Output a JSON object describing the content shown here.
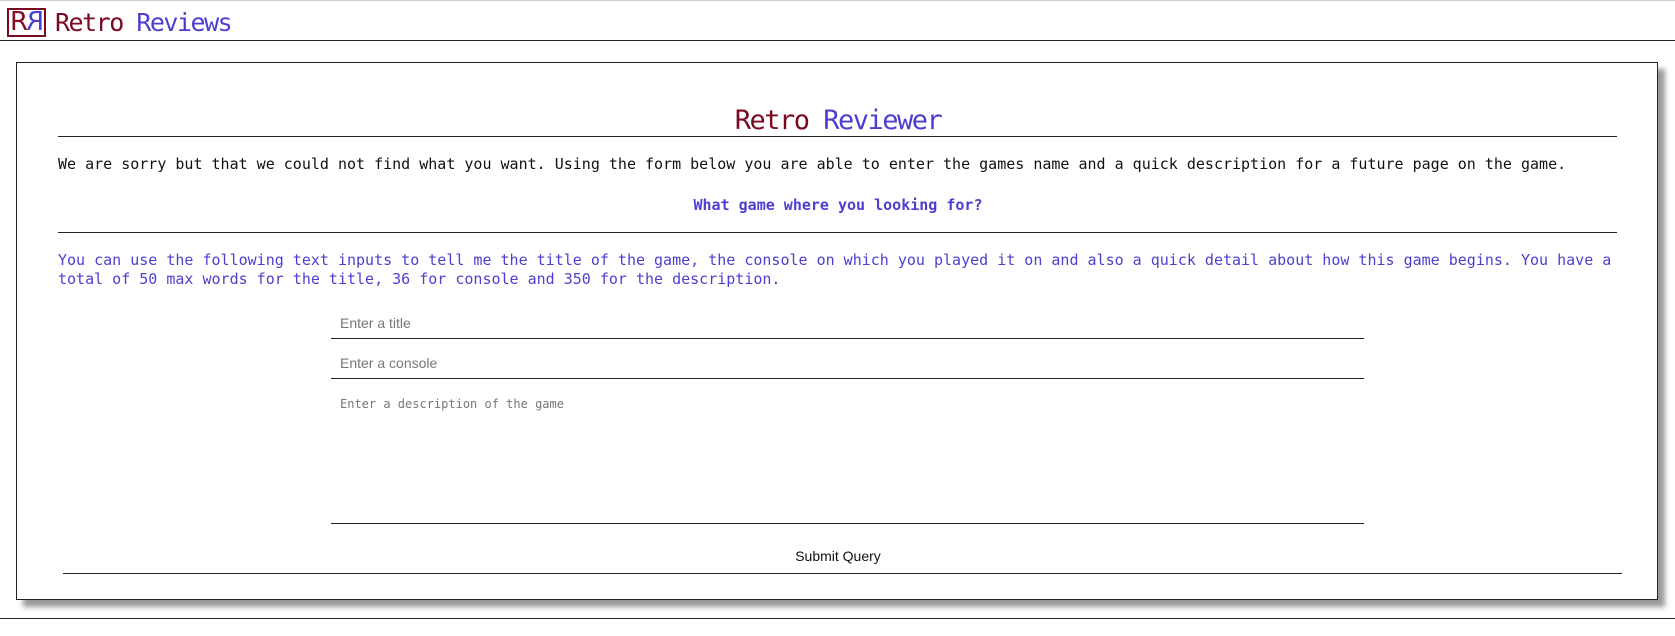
{
  "header": {
    "logo_letter_left": "R",
    "logo_letter_right": "R",
    "brand_first": "Retro",
    "brand_second": "Reviews"
  },
  "form_page": {
    "title_first": "Retro",
    "title_second": "Reviewer",
    "sorry_text": "We are sorry but that we could not find what you want. Using the form below you are able to enter the games name and a quick description for a future page on the game.",
    "question": "What game where you looking for?",
    "info_text": "You can use the following text inputs to tell me the title of the game, the console on which you played it on and also a quick detail about how this game begins. You have a total of 50 max words for the title, 36 for console and 350 for the description.",
    "title_placeholder": "Enter a title",
    "title_value": "",
    "console_placeholder": "Enter a console",
    "console_value": "",
    "description_placeholder": "Enter a description of the game",
    "description_value": "",
    "submit_label": "Submit Query"
  },
  "colors": {
    "brand_red": "#7a0a22",
    "brand_blue": "#4c3fcf",
    "text": "#111111",
    "border": "#222222"
  }
}
